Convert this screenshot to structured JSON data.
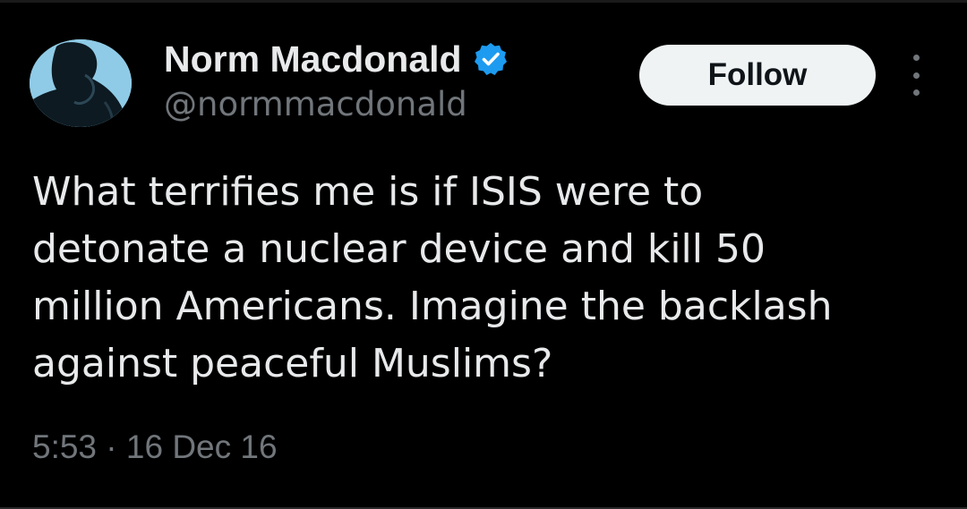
{
  "tweet": {
    "author": {
      "display_name": "Norm Macdonald",
      "handle": "@normmacdonald",
      "verified": true,
      "avatar_icon": "profile-photo"
    },
    "follow_label": "Follow",
    "more_icon": "more-vertical-icon",
    "text_lines": [
      "What terrifies me is if ISIS were to",
      "detonate a nuclear device and kill 50",
      "million Americans. Imagine the backlash",
      "against peaceful Muslims?"
    ],
    "timestamp": "5:53 · 16 Dec 16"
  },
  "colors": {
    "background": "#000000",
    "primary_text": "#e7e9ea",
    "secondary_text": "#71767b",
    "verified_blue": "#1d9bf0",
    "follow_bg": "#eff3f4"
  }
}
